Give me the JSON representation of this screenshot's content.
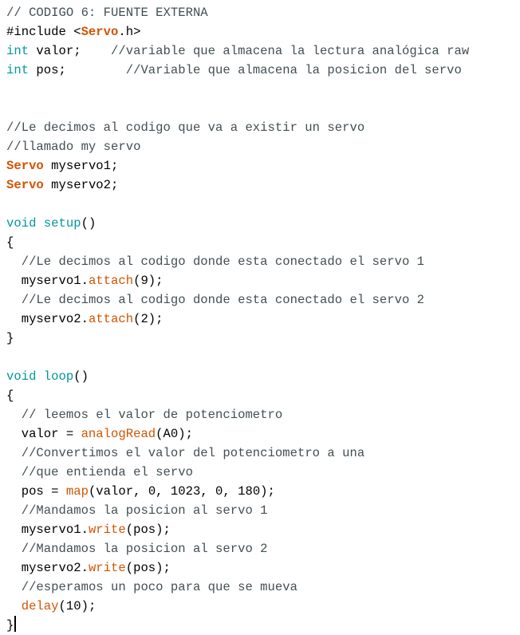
{
  "colors": {
    "background": "#ffffff",
    "comment": "#434f54",
    "keyword": "#00979c",
    "function": "#d35400",
    "plain": "#000000"
  },
  "editor": {
    "lines": [
      [
        {
          "t": "cm",
          "v": "// CODIGO 6: FUENTE EXTERNA"
        }
      ],
      [
        {
          "t": "pl",
          "v": "#include <"
        },
        {
          "t": "cls",
          "v": "Servo"
        },
        {
          "t": "pl",
          "v": ".h>"
        }
      ],
      [
        {
          "t": "kw",
          "v": "int"
        },
        {
          "t": "pl",
          "v": " valor;    "
        },
        {
          "t": "cm",
          "v": "//variable que almacena la lectura analógica raw"
        }
      ],
      [
        {
          "t": "kw",
          "v": "int"
        },
        {
          "t": "pl",
          "v": " pos;        "
        },
        {
          "t": "cm",
          "v": "//Variable que almacena la posicion del servo"
        }
      ],
      [],
      [],
      [
        {
          "t": "cm",
          "v": "//Le decimos al codigo que va a existir un servo"
        }
      ],
      [
        {
          "t": "cm",
          "v": "//llamado my servo"
        }
      ],
      [
        {
          "t": "cls",
          "v": "Servo"
        },
        {
          "t": "pl",
          "v": " myservo1;"
        }
      ],
      [
        {
          "t": "cls",
          "v": "Servo"
        },
        {
          "t": "pl",
          "v": " myservo2;"
        }
      ],
      [],
      [
        {
          "t": "kw",
          "v": "void"
        },
        {
          "t": "pl",
          "v": " "
        },
        {
          "t": "kw",
          "v": "setup"
        },
        {
          "t": "pl",
          "v": "()"
        }
      ],
      [
        {
          "t": "pl",
          "v": "{"
        }
      ],
      [
        {
          "t": "pl",
          "v": "  "
        },
        {
          "t": "cm",
          "v": "//Le decimos al codigo donde esta conectado el servo 1"
        }
      ],
      [
        {
          "t": "pl",
          "v": "  myservo1."
        },
        {
          "t": "fn",
          "v": "attach"
        },
        {
          "t": "pl",
          "v": "(9);"
        }
      ],
      [
        {
          "t": "pl",
          "v": "  "
        },
        {
          "t": "cm",
          "v": "//Le decimos al codigo donde esta conectado el servo 2"
        }
      ],
      [
        {
          "t": "pl",
          "v": "  myservo2."
        },
        {
          "t": "fn",
          "v": "attach"
        },
        {
          "t": "pl",
          "v": "(2);"
        }
      ],
      [
        {
          "t": "pl",
          "v": "}"
        }
      ],
      [],
      [
        {
          "t": "kw",
          "v": "void"
        },
        {
          "t": "pl",
          "v": " "
        },
        {
          "t": "kw",
          "v": "loop"
        },
        {
          "t": "pl",
          "v": "()"
        }
      ],
      [
        {
          "t": "pl",
          "v": "{"
        }
      ],
      [
        {
          "t": "pl",
          "v": "  "
        },
        {
          "t": "cm",
          "v": "// leemos el valor de potenciometro"
        }
      ],
      [
        {
          "t": "pl",
          "v": "  valor = "
        },
        {
          "t": "fn",
          "v": "analogRead"
        },
        {
          "t": "pl",
          "v": "(A0);"
        }
      ],
      [
        {
          "t": "pl",
          "v": "  "
        },
        {
          "t": "cm",
          "v": "//Convertimos el valor del potenciometro a una"
        }
      ],
      [
        {
          "t": "pl",
          "v": "  "
        },
        {
          "t": "cm",
          "v": "//que entienda el servo"
        }
      ],
      [
        {
          "t": "pl",
          "v": "  pos = "
        },
        {
          "t": "fn",
          "v": "map"
        },
        {
          "t": "pl",
          "v": "(valor, 0, 1023, 0, 180);"
        }
      ],
      [
        {
          "t": "pl",
          "v": "  "
        },
        {
          "t": "cm",
          "v": "//Mandamos la posicion al servo 1"
        }
      ],
      [
        {
          "t": "pl",
          "v": "  myservo1."
        },
        {
          "t": "fn",
          "v": "write"
        },
        {
          "t": "pl",
          "v": "(pos);"
        }
      ],
      [
        {
          "t": "pl",
          "v": "  "
        },
        {
          "t": "cm",
          "v": "//Mandamos la posicion al servo 2"
        }
      ],
      [
        {
          "t": "pl",
          "v": "  myservo2."
        },
        {
          "t": "fn",
          "v": "write"
        },
        {
          "t": "pl",
          "v": "(pos);"
        }
      ],
      [
        {
          "t": "pl",
          "v": "  "
        },
        {
          "t": "cm",
          "v": "//esperamos un poco para que se mueva"
        }
      ],
      [
        {
          "t": "pl",
          "v": "  "
        },
        {
          "t": "fn",
          "v": "delay"
        },
        {
          "t": "pl",
          "v": "(10);"
        }
      ],
      [
        {
          "t": "pl",
          "v": "}"
        },
        {
          "t": "cursor",
          "v": ""
        }
      ]
    ]
  }
}
